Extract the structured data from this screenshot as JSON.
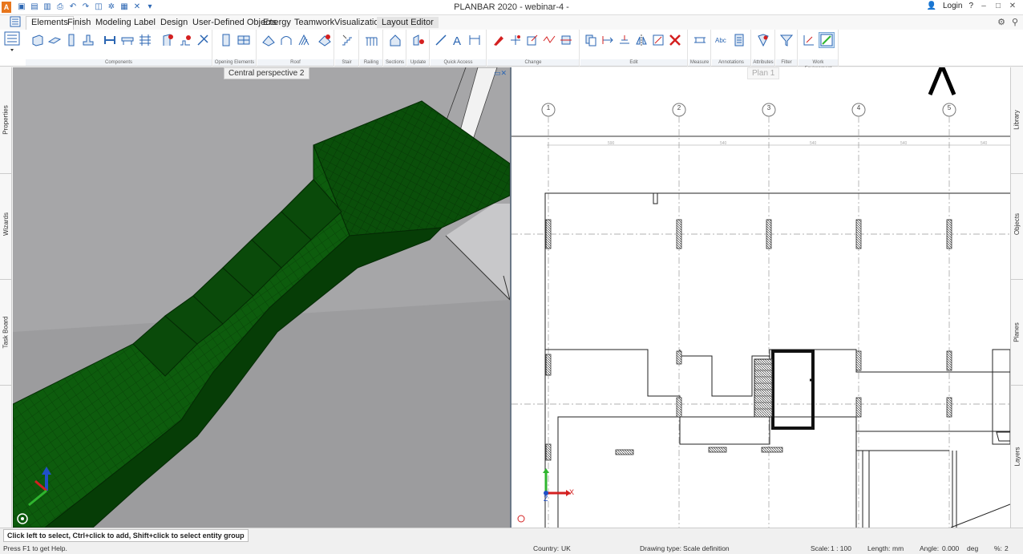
{
  "window": {
    "title": "PLANBAR 2020 - webinar-4 -",
    "login_label": "Login",
    "help_label": "?",
    "minimize": "–",
    "maximize": "□",
    "close": "✕"
  },
  "tabs": [
    {
      "label": "Elements",
      "active": true
    },
    {
      "label": "Finish"
    },
    {
      "label": "Modeling"
    },
    {
      "label": "Label"
    },
    {
      "label": "Design"
    },
    {
      "label": "User-Defined Objects"
    },
    {
      "label": "Energy"
    },
    {
      "label": "Teamwork"
    },
    {
      "label": "Visualization"
    },
    {
      "label": "Layout Editor"
    }
  ],
  "ribbon_groups": [
    {
      "label": "Components"
    },
    {
      "label": "Opening Elements"
    },
    {
      "label": "Roof"
    },
    {
      "label": "Stair"
    },
    {
      "label": "Railing"
    },
    {
      "label": "Sections"
    },
    {
      "label": "Update"
    },
    {
      "label": "Quick Access"
    },
    {
      "label": "Change"
    },
    {
      "label": "Edit"
    },
    {
      "label": "Measure"
    },
    {
      "label": "Annotations"
    },
    {
      "label": "Attributes"
    },
    {
      "label": "Filter"
    },
    {
      "label": "Work Environment"
    }
  ],
  "left_panel": [
    "Properties",
    "Wizards",
    "Task Board"
  ],
  "right_panel": [
    "Library",
    "Objects",
    "Planes",
    "Layers"
  ],
  "viewports": {
    "left_label": "Central perspective 2",
    "right_label": "Plan 1"
  },
  "plan": {
    "grid_labels": [
      "1",
      "2",
      "3",
      "4",
      "5"
    ],
    "dimension_labels": [
      "590",
      "540",
      "540",
      "540",
      "540"
    ],
    "axis_x": "X",
    "axis_z": "Z"
  },
  "prompt": "Click left to select, Ctrl+click to add, Shift+click to select entity group",
  "status": {
    "help": "Press F1 to get Help.",
    "country_label": "Country:",
    "country_value": "UK",
    "drawing_type_label": "Drawing type:",
    "drawing_type_value": "Scale definition",
    "scale_label": "Scale:",
    "scale_value": "1 : 100",
    "length_label": "Length:",
    "length_value": "mm",
    "angle_label": "Angle:",
    "angle_value": "0.000",
    "angle_unit": "deg",
    "percent_label": "%:",
    "percent_value": "2"
  },
  "colors": {
    "stair_green": "#0d5c0d",
    "stair_green_dark": "#063d06",
    "viewport_bg": "#a9a9ab",
    "axis_red": "#d42020",
    "axis_green": "#2fb52f",
    "axis_blue": "#2050c8"
  }
}
